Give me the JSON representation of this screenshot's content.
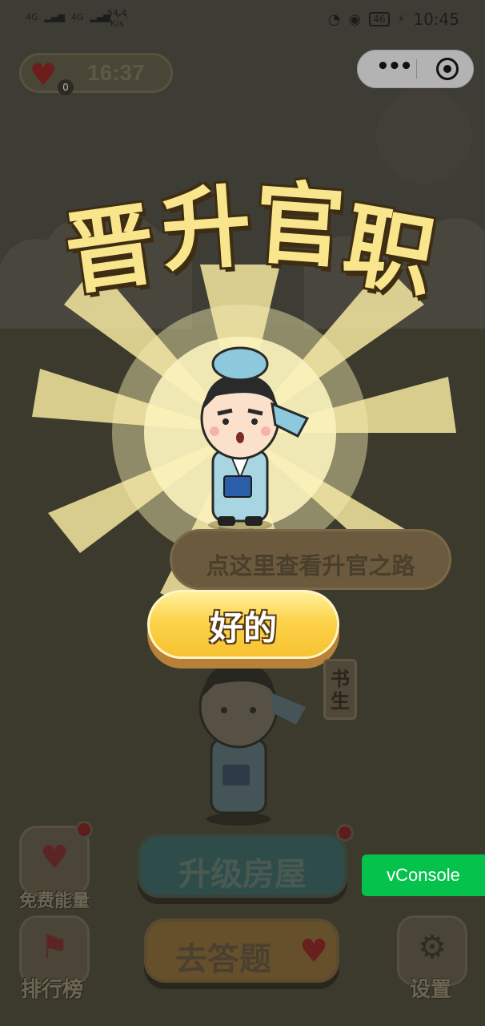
{
  "status_bar": {
    "network_1": "4G",
    "network_2": "4G",
    "speed_value": "54.4",
    "speed_unit": "K/s",
    "battery": "46",
    "time": "10:45"
  },
  "energy": {
    "count": "0",
    "timer": "16:37",
    "icon": "heart-icon"
  },
  "capsule": {
    "more_label": "•••",
    "more_icon": "more-dots-icon",
    "close_icon": "target-icon"
  },
  "popup": {
    "title_chars": [
      "晋",
      "升",
      "官",
      "职"
    ],
    "ok_label": "好的"
  },
  "hint": {
    "text": "点这里查看升官之路"
  },
  "rank": {
    "label_chars": [
      "书",
      "生"
    ]
  },
  "bottom": {
    "free_energy_label": "免费能量",
    "leaderboard_label": "排行榜",
    "settings_label": "设置",
    "upgrade_house_label": "升级房屋",
    "quiz_label": "去答题"
  },
  "vconsole": {
    "label": "vConsole"
  },
  "colors": {
    "overlay_bg": "#3b3a31",
    "status_bar_bg": "#3c3b31",
    "title_fill": "#f9e58c",
    "ok_button": "#fcd34a",
    "vconsole": "#05c24c"
  }
}
